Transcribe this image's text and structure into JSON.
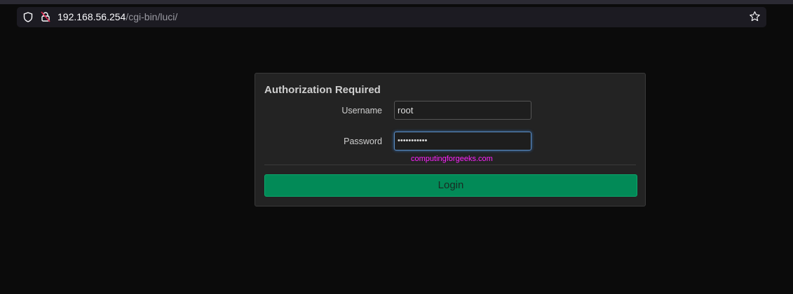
{
  "browser": {
    "url_host": "192.168.56.254",
    "url_path": "/cgi-bin/luci/",
    "icons": [
      "shield-icon",
      "insecure-lock-icon",
      "star-icon"
    ]
  },
  "login": {
    "title": "Authorization Required",
    "username_label": "Username",
    "username_value": "root",
    "password_label": "Password",
    "password_value": "•••••••••••",
    "watermark": "computingforgeeks.com",
    "login_button": "Login",
    "accent": "#028a57"
  }
}
